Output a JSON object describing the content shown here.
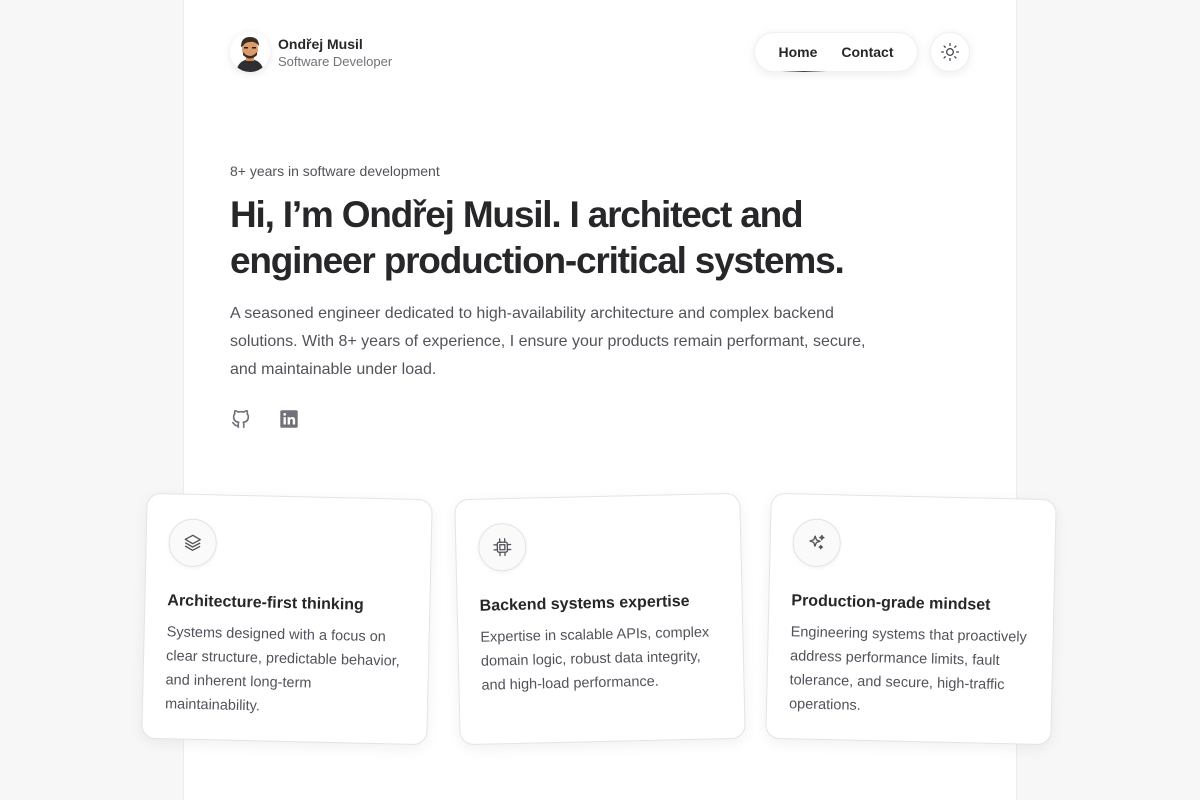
{
  "header": {
    "name": "Ondřej Musil",
    "role": "Software Developer",
    "nav": [
      {
        "label": "Home",
        "active": true
      },
      {
        "label": "Contact",
        "active": false
      }
    ],
    "theme_toggle_icon": "sun-icon"
  },
  "hero": {
    "eyebrow": "8+ years in software development",
    "headline": "Hi, I’m Ondřej Musil. I architect and engineer production-critical systems.",
    "lead": "A seasoned engineer dedicated to high-availability architecture and complex backend solutions. With 8+ years of experience, I ensure your products remain performant, secure, and maintainable under load.",
    "socials": [
      {
        "icon": "github-icon"
      },
      {
        "icon": "linkedin-icon"
      }
    ]
  },
  "cards": [
    {
      "icon": "layers-icon",
      "title": "Architecture-first thinking",
      "description": "Systems designed with a focus on clear structure, predictable behavior, and inherent long-term maintainability."
    },
    {
      "icon": "cpu-icon",
      "title": "Backend systems expertise",
      "description": "Expertise in scalable APIs, complex domain logic, robust data integrity, and high-load performance."
    },
    {
      "icon": "sparkles-icon",
      "title": "Production-grade mindset",
      "description": "Engineering systems that proactively address performance limits, fault tolerance, and secure, high-traffic operations."
    }
  ],
  "colors": {
    "background": "#f7f7f8",
    "surface": "#ffffff",
    "text": "#27272a",
    "muted": "#52525b"
  }
}
